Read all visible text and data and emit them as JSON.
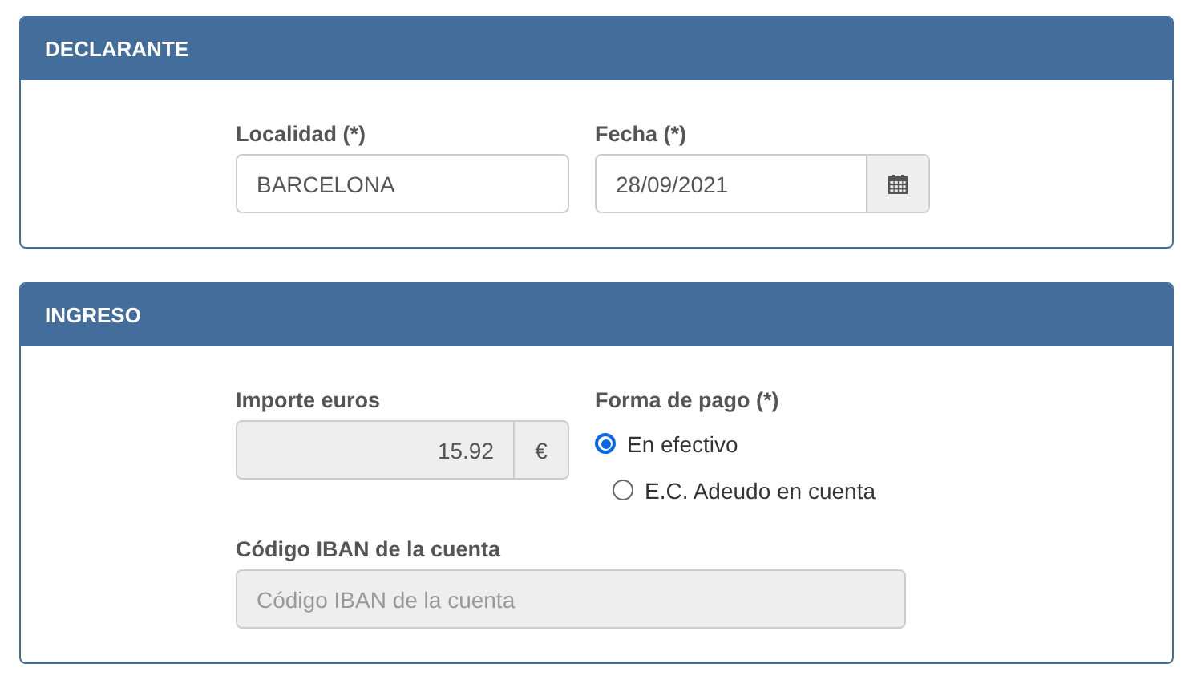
{
  "sections": [
    {
      "title": "DECLARANTE",
      "rows": [
        [
          {
            "kind": "text",
            "label": "Localidad (*)",
            "value": "BARCELONA"
          },
          {
            "kind": "date",
            "label": "Fecha (*)",
            "value": "28/09/2021"
          }
        ]
      ]
    },
    {
      "title": "INGRESO",
      "rows": [
        [
          {
            "kind": "amount",
            "label": "Importe euros",
            "value": "15.92",
            "unit": "€",
            "disabled": true
          },
          {
            "kind": "radio",
            "label": "Forma de pago (*)",
            "options": [
              {
                "label": "En efectivo",
                "selected": true
              },
              {
                "label": "E.C. Adeudo en cuenta",
                "selected": false
              }
            ]
          }
        ],
        [
          {
            "kind": "text",
            "label": "Código IBAN de la cuenta",
            "placeholder": "Código IBAN de la cuenta",
            "disabled": true
          }
        ]
      ]
    }
  ]
}
